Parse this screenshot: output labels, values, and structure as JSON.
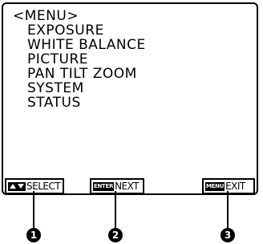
{
  "menu": {
    "title": "<MENU>",
    "items": [
      {
        "label": "EXPOSURE"
      },
      {
        "label": "WHITE BALANCE"
      },
      {
        "label": "PICTURE"
      },
      {
        "label": "PAN TILT ZOOM"
      },
      {
        "label": "SYSTEM"
      },
      {
        "label": "STATUS"
      }
    ]
  },
  "buttons": {
    "select": {
      "icon": "up-down-arrows-icon",
      "label": "SELECT"
    },
    "next": {
      "icon_text": "ENTER",
      "label": "NEXT"
    },
    "exit": {
      "icon_text": "MENU",
      "label": "EXIT"
    }
  },
  "callouts": [
    "1",
    "2",
    "3"
  ]
}
